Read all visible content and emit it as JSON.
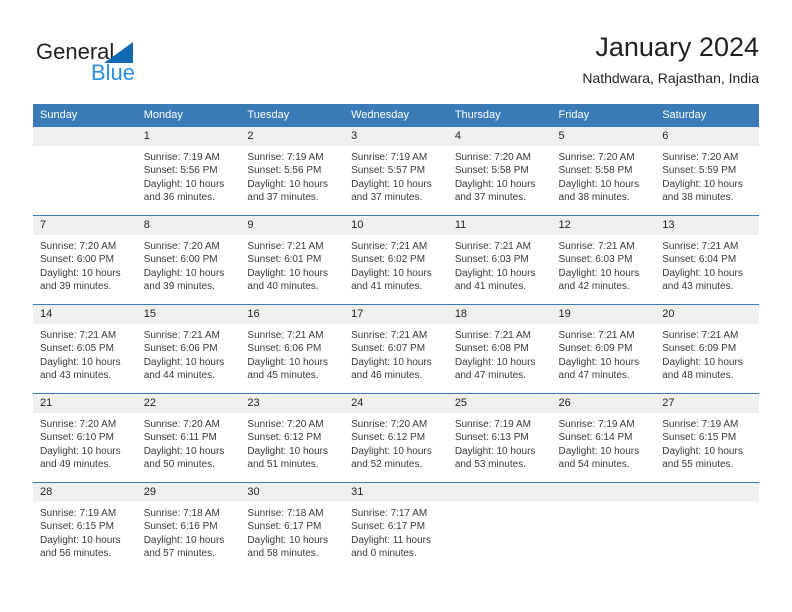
{
  "logo": {
    "part1": "General",
    "part2": "Blue",
    "triangle_color": "#1268b3",
    "blue_color": "#2b8fe0"
  },
  "header": {
    "title": "January 2024",
    "subtitle": "Nathdwara, Rajasthan, India"
  },
  "theme": {
    "header_blue": "#3b7cb8",
    "daynum_bg": "#efefef",
    "text": "#231f20"
  },
  "weekdays": [
    "Sunday",
    "Monday",
    "Tuesday",
    "Wednesday",
    "Thursday",
    "Friday",
    "Saturday"
  ],
  "weeks": [
    [
      {
        "day": "",
        "lines": []
      },
      {
        "day": "1",
        "lines": [
          "Sunrise: 7:19 AM",
          "Sunset: 5:56 PM",
          "Daylight: 10 hours",
          "and 36 minutes."
        ]
      },
      {
        "day": "2",
        "lines": [
          "Sunrise: 7:19 AM",
          "Sunset: 5:56 PM",
          "Daylight: 10 hours",
          "and 37 minutes."
        ]
      },
      {
        "day": "3",
        "lines": [
          "Sunrise: 7:19 AM",
          "Sunset: 5:57 PM",
          "Daylight: 10 hours",
          "and 37 minutes."
        ]
      },
      {
        "day": "4",
        "lines": [
          "Sunrise: 7:20 AM",
          "Sunset: 5:58 PM",
          "Daylight: 10 hours",
          "and 37 minutes."
        ]
      },
      {
        "day": "5",
        "lines": [
          "Sunrise: 7:20 AM",
          "Sunset: 5:58 PM",
          "Daylight: 10 hours",
          "and 38 minutes."
        ]
      },
      {
        "day": "6",
        "lines": [
          "Sunrise: 7:20 AM",
          "Sunset: 5:59 PM",
          "Daylight: 10 hours",
          "and 38 minutes."
        ]
      }
    ],
    [
      {
        "day": "7",
        "lines": [
          "Sunrise: 7:20 AM",
          "Sunset: 6:00 PM",
          "Daylight: 10 hours",
          "and 39 minutes."
        ]
      },
      {
        "day": "8",
        "lines": [
          "Sunrise: 7:20 AM",
          "Sunset: 6:00 PM",
          "Daylight: 10 hours",
          "and 39 minutes."
        ]
      },
      {
        "day": "9",
        "lines": [
          "Sunrise: 7:21 AM",
          "Sunset: 6:01 PM",
          "Daylight: 10 hours",
          "and 40 minutes."
        ]
      },
      {
        "day": "10",
        "lines": [
          "Sunrise: 7:21 AM",
          "Sunset: 6:02 PM",
          "Daylight: 10 hours",
          "and 41 minutes."
        ]
      },
      {
        "day": "11",
        "lines": [
          "Sunrise: 7:21 AM",
          "Sunset: 6:03 PM",
          "Daylight: 10 hours",
          "and 41 minutes."
        ]
      },
      {
        "day": "12",
        "lines": [
          "Sunrise: 7:21 AM",
          "Sunset: 6:03 PM",
          "Daylight: 10 hours",
          "and 42 minutes."
        ]
      },
      {
        "day": "13",
        "lines": [
          "Sunrise: 7:21 AM",
          "Sunset: 6:04 PM",
          "Daylight: 10 hours",
          "and 43 minutes."
        ]
      }
    ],
    [
      {
        "day": "14",
        "lines": [
          "Sunrise: 7:21 AM",
          "Sunset: 6:05 PM",
          "Daylight: 10 hours",
          "and 43 minutes."
        ]
      },
      {
        "day": "15",
        "lines": [
          "Sunrise: 7:21 AM",
          "Sunset: 6:06 PM",
          "Daylight: 10 hours",
          "and 44 minutes."
        ]
      },
      {
        "day": "16",
        "lines": [
          "Sunrise: 7:21 AM",
          "Sunset: 6:06 PM",
          "Daylight: 10 hours",
          "and 45 minutes."
        ]
      },
      {
        "day": "17",
        "lines": [
          "Sunrise: 7:21 AM",
          "Sunset: 6:07 PM",
          "Daylight: 10 hours",
          "and 46 minutes."
        ]
      },
      {
        "day": "18",
        "lines": [
          "Sunrise: 7:21 AM",
          "Sunset: 6:08 PM",
          "Daylight: 10 hours",
          "and 47 minutes."
        ]
      },
      {
        "day": "19",
        "lines": [
          "Sunrise: 7:21 AM",
          "Sunset: 6:09 PM",
          "Daylight: 10 hours",
          "and 47 minutes."
        ]
      },
      {
        "day": "20",
        "lines": [
          "Sunrise: 7:21 AM",
          "Sunset: 6:09 PM",
          "Daylight: 10 hours",
          "and 48 minutes."
        ]
      }
    ],
    [
      {
        "day": "21",
        "lines": [
          "Sunrise: 7:20 AM",
          "Sunset: 6:10 PM",
          "Daylight: 10 hours",
          "and 49 minutes."
        ]
      },
      {
        "day": "22",
        "lines": [
          "Sunrise: 7:20 AM",
          "Sunset: 6:11 PM",
          "Daylight: 10 hours",
          "and 50 minutes."
        ]
      },
      {
        "day": "23",
        "lines": [
          "Sunrise: 7:20 AM",
          "Sunset: 6:12 PM",
          "Daylight: 10 hours",
          "and 51 minutes."
        ]
      },
      {
        "day": "24",
        "lines": [
          "Sunrise: 7:20 AM",
          "Sunset: 6:12 PM",
          "Daylight: 10 hours",
          "and 52 minutes."
        ]
      },
      {
        "day": "25",
        "lines": [
          "Sunrise: 7:19 AM",
          "Sunset: 6:13 PM",
          "Daylight: 10 hours",
          "and 53 minutes."
        ]
      },
      {
        "day": "26",
        "lines": [
          "Sunrise: 7:19 AM",
          "Sunset: 6:14 PM",
          "Daylight: 10 hours",
          "and 54 minutes."
        ]
      },
      {
        "day": "27",
        "lines": [
          "Sunrise: 7:19 AM",
          "Sunset: 6:15 PM",
          "Daylight: 10 hours",
          "and 55 minutes."
        ]
      }
    ],
    [
      {
        "day": "28",
        "lines": [
          "Sunrise: 7:19 AM",
          "Sunset: 6:15 PM",
          "Daylight: 10 hours",
          "and 56 minutes."
        ]
      },
      {
        "day": "29",
        "lines": [
          "Sunrise: 7:18 AM",
          "Sunset: 6:16 PM",
          "Daylight: 10 hours",
          "and 57 minutes."
        ]
      },
      {
        "day": "30",
        "lines": [
          "Sunrise: 7:18 AM",
          "Sunset: 6:17 PM",
          "Daylight: 10 hours",
          "and 58 minutes."
        ]
      },
      {
        "day": "31",
        "lines": [
          "Sunrise: 7:17 AM",
          "Sunset: 6:17 PM",
          "Daylight: 11 hours",
          "and 0 minutes."
        ]
      },
      {
        "day": "",
        "lines": []
      },
      {
        "day": "",
        "lines": []
      },
      {
        "day": "",
        "lines": []
      }
    ]
  ]
}
